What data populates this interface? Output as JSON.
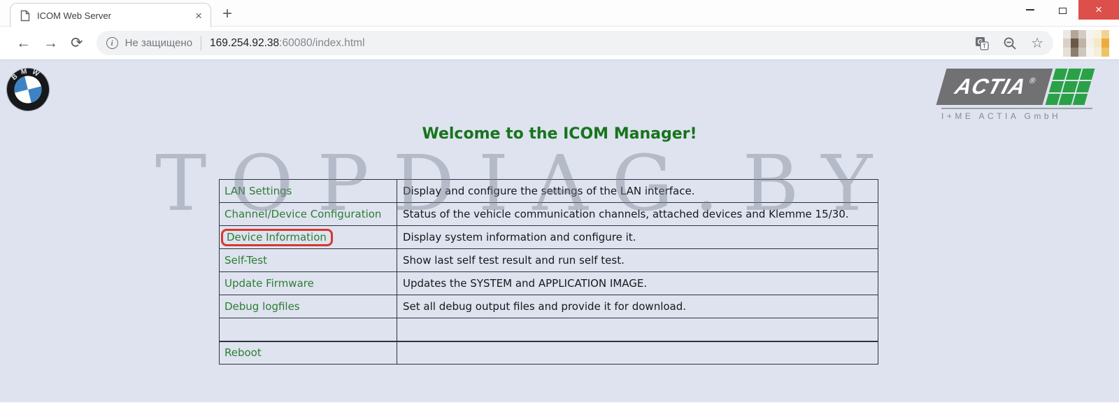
{
  "browser": {
    "tab": {
      "title": "ICOM Web Server"
    },
    "icons": {
      "tab_close": "×",
      "new_tab": "+",
      "window_close": "×",
      "back": "←",
      "forward": "→",
      "reload": "⟳",
      "info": "i",
      "star": "☆"
    },
    "omnibox": {
      "security_text": "Не защищено",
      "url_host": "169.254.92.38",
      "url_rest": ":60080/index.html"
    }
  },
  "page": {
    "heading": "Welcome to the ICOM Manager!",
    "watermark": "TOPDIAG.BY",
    "bmw_letters": "BMW",
    "actia": {
      "brand": "ACTIA",
      "reg": "®",
      "subtitle": "I+ME ACTIA GmbH"
    },
    "menu": {
      "rows": [
        {
          "label": "LAN Settings",
          "desc": "Display and configure the settings of the LAN interface."
        },
        {
          "label": "Channel/Device Configuration",
          "desc": "Status of the vehicle communication channels, attached devices and Klemme 15/30."
        },
        {
          "label": "Device Information",
          "desc": "Display system information and configure it.",
          "highlighted": true
        },
        {
          "label": "Self-Test",
          "desc": "Show last self test result and run self test."
        },
        {
          "label": "Update Firmware",
          "desc": "Updates the SYSTEM and APPLICATION IMAGE."
        },
        {
          "label": "Debug logfiles",
          "desc": "Set all debug output files and provide it for download."
        },
        {
          "label": "",
          "desc": ""
        },
        {
          "label": "Reboot",
          "desc": ""
        }
      ]
    },
    "colors": {
      "page_bg": "#dee3ef",
      "link_green": "#2e7d33",
      "heading_green": "#17741c",
      "highlight_red": "#d6382f",
      "close_red": "#dd4f4a",
      "actia_green": "#2aa146"
    }
  }
}
